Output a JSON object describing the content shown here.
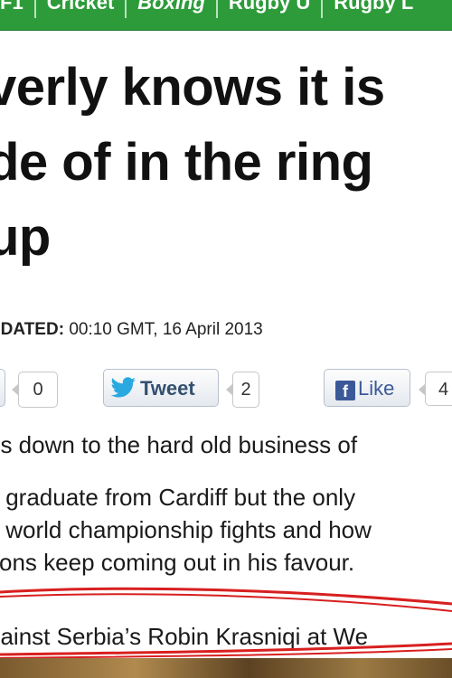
{
  "nav": {
    "items": [
      "F1",
      "Cricket",
      "Boxing",
      "Rugby U",
      "Rugby L"
    ],
    "active": "Boxing"
  },
  "headline": {
    "lines": [
      "verly knows it is",
      "de of in the ring",
      "up"
    ]
  },
  "updated": {
    "label": "PDATED:",
    "value": " 00:10 GMT, 16 April 2013"
  },
  "share": {
    "first_count": "0",
    "tweet_label": "Tweet",
    "tweet_count": "2",
    "like_label": "Like",
    "like_count": "4"
  },
  "article": {
    "p1": "es down to the hard old business of",
    "p2_lines": [
      "s graduate from Cardiff but the only",
      "s world championship fights and how",
      "tions keep coming out in his favour."
    ],
    "p3": "gainst Serbia’s Robin Krasniqi at We"
  },
  "colors": {
    "nav_green": "#2d9b3a",
    "annotation_red": "#d81f1f",
    "facebook_blue": "#3b5998",
    "twitter_blue": "#2aa9e0"
  }
}
